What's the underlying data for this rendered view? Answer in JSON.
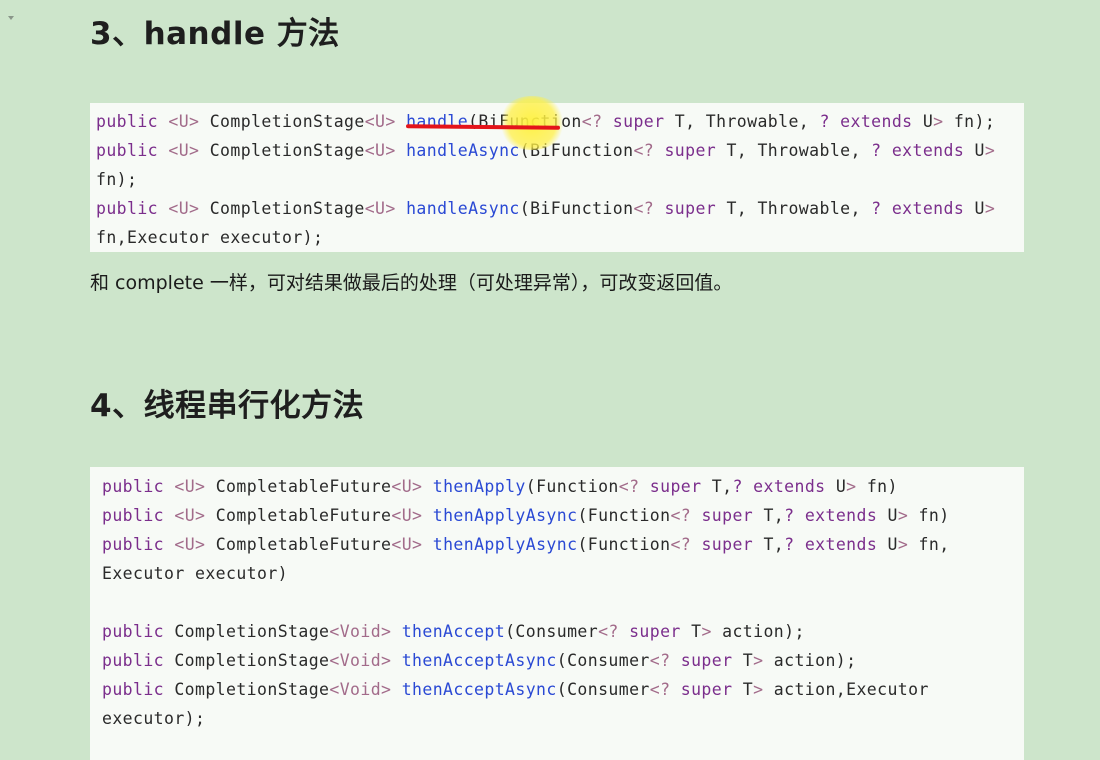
{
  "section3": {
    "heading": "3、handle 方法",
    "code_lines": [
      [
        {
          "t": "public",
          "c": "kw"
        },
        {
          "t": " "
        },
        {
          "t": "<U>",
          "c": "gen"
        },
        {
          "t": " CompletionStage"
        },
        {
          "t": "<U>",
          "c": "gen"
        },
        {
          "t": " "
        },
        {
          "t": "handle",
          "c": "mth"
        },
        {
          "t": "(BiFunction"
        },
        {
          "t": "<?",
          "c": "gen"
        },
        {
          "t": " "
        },
        {
          "t": "super",
          "c": "sup"
        },
        {
          "t": " T, Throwable, "
        },
        {
          "t": "? extends",
          "c": "sup"
        },
        {
          "t": " U"
        },
        {
          "t": ">",
          "c": "gen"
        },
        {
          "t": " fn);"
        }
      ],
      [
        {
          "t": "public",
          "c": "kw"
        },
        {
          "t": " "
        },
        {
          "t": "<U>",
          "c": "gen"
        },
        {
          "t": " CompletionStage"
        },
        {
          "t": "<U>",
          "c": "gen"
        },
        {
          "t": " "
        },
        {
          "t": "handleAsync",
          "c": "mth"
        },
        {
          "t": "(BiFunction"
        },
        {
          "t": "<?",
          "c": "gen"
        },
        {
          "t": " "
        },
        {
          "t": "super",
          "c": "sup"
        },
        {
          "t": " T, Throwable, "
        },
        {
          "t": "? extends",
          "c": "sup"
        },
        {
          "t": " U"
        },
        {
          "t": ">",
          "c": "gen"
        }
      ],
      [
        {
          "t": "fn);"
        }
      ],
      [
        {
          "t": "public",
          "c": "kw"
        },
        {
          "t": " "
        },
        {
          "t": "<U>",
          "c": "gen"
        },
        {
          "t": " CompletionStage"
        },
        {
          "t": "<U>",
          "c": "gen"
        },
        {
          "t": " "
        },
        {
          "t": "handleAsync",
          "c": "mth"
        },
        {
          "t": "(BiFunction"
        },
        {
          "t": "<?",
          "c": "gen"
        },
        {
          "t": " "
        },
        {
          "t": "super",
          "c": "sup"
        },
        {
          "t": " T, Throwable, "
        },
        {
          "t": "? extends",
          "c": "sup"
        },
        {
          "t": " U"
        },
        {
          "t": ">",
          "c": "gen"
        }
      ],
      [
        {
          "t": "fn,Executor executor);"
        }
      ]
    ],
    "description": "和 complete 一样，可对结果做最后的处理（可处理异常），可改变返回值。"
  },
  "section4": {
    "heading": "4、线程串行化方法",
    "code_lines": [
      [
        {
          "t": "public",
          "c": "kw"
        },
        {
          "t": " "
        },
        {
          "t": "<U>",
          "c": "gen"
        },
        {
          "t": " CompletableFuture"
        },
        {
          "t": "<U>",
          "c": "gen"
        },
        {
          "t": " "
        },
        {
          "t": "thenApply",
          "c": "mth"
        },
        {
          "t": "(Function"
        },
        {
          "t": "<?",
          "c": "gen"
        },
        {
          "t": " "
        },
        {
          "t": "super",
          "c": "sup"
        },
        {
          "t": " T,"
        },
        {
          "t": "? extends",
          "c": "sup"
        },
        {
          "t": " U"
        },
        {
          "t": ">",
          "c": "gen"
        },
        {
          "t": " fn)"
        }
      ],
      [
        {
          "t": "public",
          "c": "kw"
        },
        {
          "t": " "
        },
        {
          "t": "<U>",
          "c": "gen"
        },
        {
          "t": " CompletableFuture"
        },
        {
          "t": "<U>",
          "c": "gen"
        },
        {
          "t": " "
        },
        {
          "t": "thenApplyAsync",
          "c": "mth"
        },
        {
          "t": "(Function"
        },
        {
          "t": "<?",
          "c": "gen"
        },
        {
          "t": " "
        },
        {
          "t": "super",
          "c": "sup"
        },
        {
          "t": " T,"
        },
        {
          "t": "? extends",
          "c": "sup"
        },
        {
          "t": " U"
        },
        {
          "t": ">",
          "c": "gen"
        },
        {
          "t": " fn)"
        }
      ],
      [
        {
          "t": "public",
          "c": "kw"
        },
        {
          "t": " "
        },
        {
          "t": "<U>",
          "c": "gen"
        },
        {
          "t": " CompletableFuture"
        },
        {
          "t": "<U>",
          "c": "gen"
        },
        {
          "t": " "
        },
        {
          "t": "thenApplyAsync",
          "c": "mth"
        },
        {
          "t": "(Function"
        },
        {
          "t": "<?",
          "c": "gen"
        },
        {
          "t": " "
        },
        {
          "t": "super",
          "c": "sup"
        },
        {
          "t": " T,"
        },
        {
          "t": "? extends",
          "c": "sup"
        },
        {
          "t": " U"
        },
        {
          "t": ">",
          "c": "gen"
        },
        {
          "t": " fn,"
        }
      ],
      [
        {
          "t": "Executor executor)"
        }
      ],
      [],
      [
        {
          "t": "public",
          "c": "kw"
        },
        {
          "t": " CompletionStage"
        },
        {
          "t": "<Void>",
          "c": "gen"
        },
        {
          "t": " "
        },
        {
          "t": "thenAccept",
          "c": "mth"
        },
        {
          "t": "(Consumer"
        },
        {
          "t": "<?",
          "c": "gen"
        },
        {
          "t": " "
        },
        {
          "t": "super",
          "c": "sup"
        },
        {
          "t": " T"
        },
        {
          "t": ">",
          "c": "gen"
        },
        {
          "t": " action);"
        }
      ],
      [
        {
          "t": "public",
          "c": "kw"
        },
        {
          "t": " CompletionStage"
        },
        {
          "t": "<Void>",
          "c": "gen"
        },
        {
          "t": " "
        },
        {
          "t": "thenAcceptAsync",
          "c": "mth"
        },
        {
          "t": "(Consumer"
        },
        {
          "t": "<?",
          "c": "gen"
        },
        {
          "t": " "
        },
        {
          "t": "super",
          "c": "sup"
        },
        {
          "t": " T"
        },
        {
          "t": ">",
          "c": "gen"
        },
        {
          "t": " action);"
        }
      ],
      [
        {
          "t": "public",
          "c": "kw"
        },
        {
          "t": " CompletionStage"
        },
        {
          "t": "<Void>",
          "c": "gen"
        },
        {
          "t": " "
        },
        {
          "t": "thenAcceptAsync",
          "c": "mth"
        },
        {
          "t": "(Consumer"
        },
        {
          "t": "<?",
          "c": "gen"
        },
        {
          "t": " "
        },
        {
          "t": "super",
          "c": "sup"
        },
        {
          "t": " T"
        },
        {
          "t": ">",
          "c": "gen"
        },
        {
          "t": " action,Executor"
        }
      ],
      [
        {
          "t": "executor);"
        }
      ]
    ]
  },
  "colors": {
    "page_background": "#cde5cb",
    "code_background": "#f7faf6",
    "keyword": "#7b2e8c",
    "method": "#2a49d4",
    "generic": "#a26b8a",
    "annotation_underline": "#e4141a",
    "annotation_highlight": "#fff23c"
  }
}
